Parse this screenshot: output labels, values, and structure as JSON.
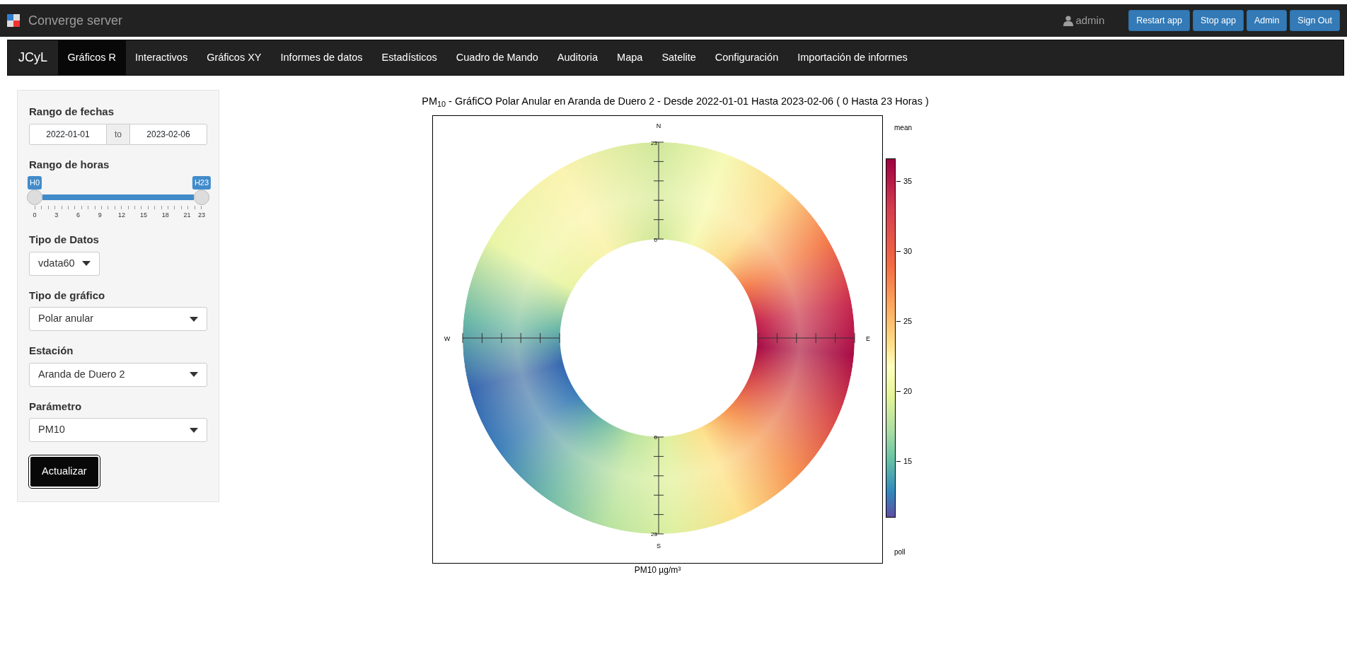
{
  "header": {
    "title": "Converge server",
    "user": "admin",
    "buttons": [
      "Restart app",
      "Stop app",
      "Admin",
      "Sign Out"
    ]
  },
  "nav": {
    "brand": "JCyL",
    "tabs": [
      {
        "label": "Gráficos R",
        "selected": true
      },
      {
        "label": "Interactivos",
        "selected": false
      },
      {
        "label": "Gráficos XY",
        "selected": false
      },
      {
        "label": "Informes de datos",
        "selected": false
      },
      {
        "label": "Estadísticos",
        "selected": false
      },
      {
        "label": "Cuadro de Mando",
        "selected": false
      },
      {
        "label": "Auditoria",
        "selected": false
      },
      {
        "label": "Mapa",
        "selected": false
      },
      {
        "label": "Satelite",
        "selected": false
      },
      {
        "label": "Configuración",
        "selected": false
      },
      {
        "label": "Importación de informes",
        "selected": false
      }
    ]
  },
  "sidebar": {
    "date_range": {
      "label": "Rango de fechas",
      "from": "2022-01-01",
      "separator": "to",
      "to": "2023-02-06"
    },
    "hour_range": {
      "label": "Rango de horas",
      "from_label": "H0",
      "to_label": "H23",
      "level": 1,
      "ticks": [
        "0",
        "3",
        "6",
        "9",
        "12",
        "15",
        "18",
        "21",
        "23"
      ]
    },
    "selects": [
      {
        "label": "Tipo de Datos",
        "value": "vdata60",
        "narrow": true
      },
      {
        "label": "Tipo de gráfico",
        "value": "Polar anular",
        "narrow": false
      },
      {
        "label": "Estación",
        "value": "Aranda de Duero 2",
        "narrow": false
      },
      {
        "label": "Parámetro",
        "value": "PM10",
        "narrow": false
      }
    ],
    "button": "Actualizar"
  },
  "plot": {
    "title": "PM$_{10}$ - GráfiCO Polar Anular en Aranda de Duero 2 - Desde 2022-01-01 Hasta 2023-02-06  ( 0 Hasta 23 Horas )",
    "compass": [
      "N",
      "E",
      "S",
      "W"
    ],
    "north_axis": [
      "23",
      "0"
    ],
    "south_axis": [
      "0",
      "23"
    ],
    "xlabel": "PM10  µg/m³",
    "legend_title": "mean",
    "legend_footer": "poll",
    "legend_ticks": [
      "35",
      "30",
      "25",
      "20",
      "15"
    ]
  }
}
